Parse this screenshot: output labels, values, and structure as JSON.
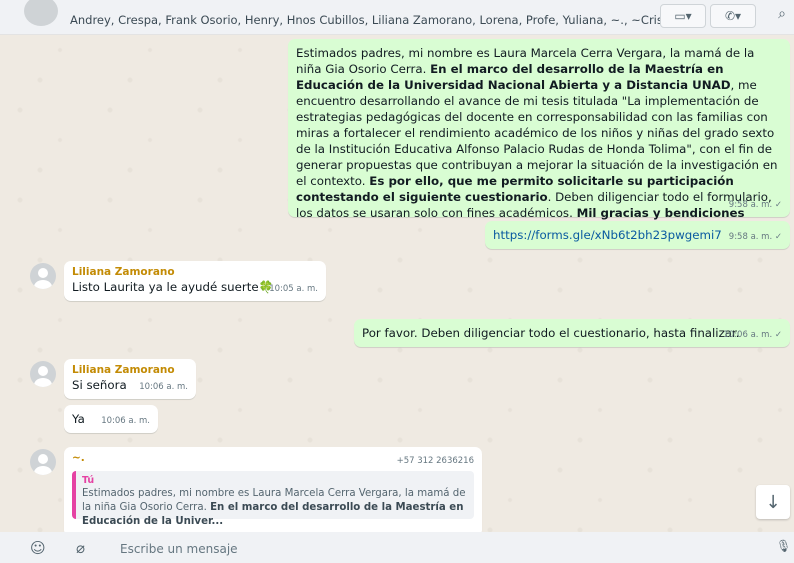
{
  "header": {
    "participants": "Andrey, Crespa, Frank Osorio, Henry, Hnos Cubillos, Liliana Zamorano, Lorena, Profe, Yuliana, ~., ~Cristian,..."
  },
  "messages": {
    "m1": {
      "t1": "Estimados padres, mi nombre es Laura Marcela Cerra Vergara, la mamá de la niña Gia Osorio Cerra. ",
      "b1": "En el marco del desarrollo de la Maestría en Educación de la Universidad Nacional Abierta y a Distancia UNAD",
      "t2": ", me encuentro desarrollando el avance de mi tesis titulada \"La implementación de estrategias pedagógicas del docente en corresponsabilidad con las familias con miras a fortalecer el rendimiento académico de los niños y niñas del grado sexto de la Institución Educativa Alfonso Palacio Rudas de Honda Tolima\", con el fin de generar propuestas que contribuyan a mejorar la situación de la investigación en el contexto. ",
      "b2": "Es por ello, que me permito solicitarle su participación contestando el siguiente cuestionario",
      "t3": ".  Deben diligenciar todo el formulario, los datos se usaran solo con fines académicos. ",
      "b3": "Mil gracias y bendiciones",
      "time": "9:58 a. m. ✓"
    },
    "m2": {
      "link": "https://forms.gle/xNb6t2bh23pwgemi7",
      "time": "9:58 a. m. ✓"
    },
    "m3": {
      "sender": "Liliana Zamorano",
      "text": "Listo Laurita ya le ayudé suerte",
      "emoji": "🍀",
      "time": "10:05 a. m."
    },
    "m4": {
      "text": "Por favor. Deben diligenciar todo el cuestionario, hasta finalizar.",
      "time": "10:06 a. m. ✓"
    },
    "m5": {
      "sender": "Liliana Zamorano",
      "text": "Si señora",
      "time": "10:06 a. m."
    },
    "m6": {
      "text": "Ya",
      "time": "10:06 a. m."
    },
    "m7": {
      "sender": "~.",
      "phone": "+57 312 2636216",
      "quote_author": "Tú",
      "quote_text": "Estimados padres, mi nombre es Laura Marcela Cerra Vergara, la mamá de la niña Gia Osorio Cerra. ",
      "quote_bold": "En el marco del desarrollo de la Maestría en Educación de la Univer..."
    }
  },
  "footer": {
    "placeholder": "Escribe un mensaje"
  },
  "icons": {
    "video": "▭▾",
    "call": "✆▾",
    "search": "⌕",
    "scroll": "↓",
    "emoji": "☺",
    "attach": "⌀",
    "mic": "🎙"
  },
  "colors": {
    "outgoing": "#d9fdd3",
    "incoming": "#ffffff",
    "sender_name": "#c38b05",
    "quote_accent": "#e542a3",
    "link": "#0a5aa0"
  }
}
